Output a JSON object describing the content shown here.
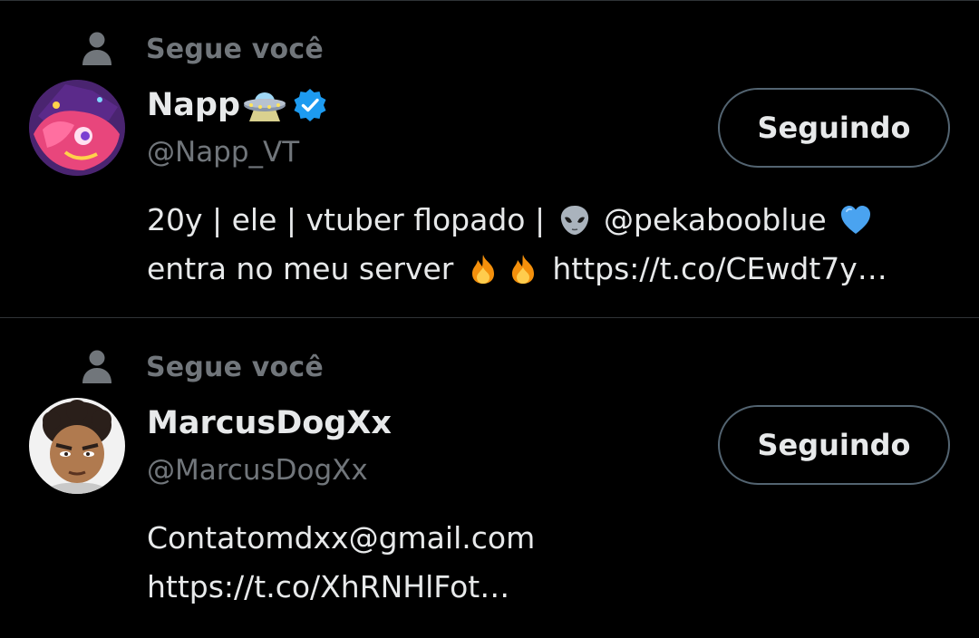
{
  "colors": {
    "background": "#000000",
    "primary_text": "#e7e9ea",
    "secondary_text": "#71767b",
    "divider": "#2f3336",
    "verified_badge": "#1d9bf0",
    "button_border": "#536471"
  },
  "users": [
    {
      "context_icon": "person-icon",
      "context_text": "Segue você",
      "name": "Napp",
      "name_emoji": "ufo-emoji",
      "verified": true,
      "handle": "@Napp_VT",
      "bio_line1_a": "20y | ele | vtuber flopado | ",
      "bio_line1_emoji": "alien-emoji",
      "bio_line1_b": " @pekabooblue ",
      "bio_line1_emoji2": "blue-heart-emoji",
      "bio_line2_a": "entra no meu server ",
      "bio_line2_emoji": "fire-emoji",
      "bio_line2_b": " https://t.co/CEwdt7y…",
      "button_label": "Seguindo"
    },
    {
      "context_icon": "person-icon",
      "context_text": "Segue você",
      "name": "MarcusDogXx",
      "handle": "@MarcusDogXx",
      "bio_line1": "Contatomdxx@gmail.com",
      "bio_line2": "https://t.co/XhRNHlFot…",
      "button_label": "Seguindo"
    }
  ]
}
